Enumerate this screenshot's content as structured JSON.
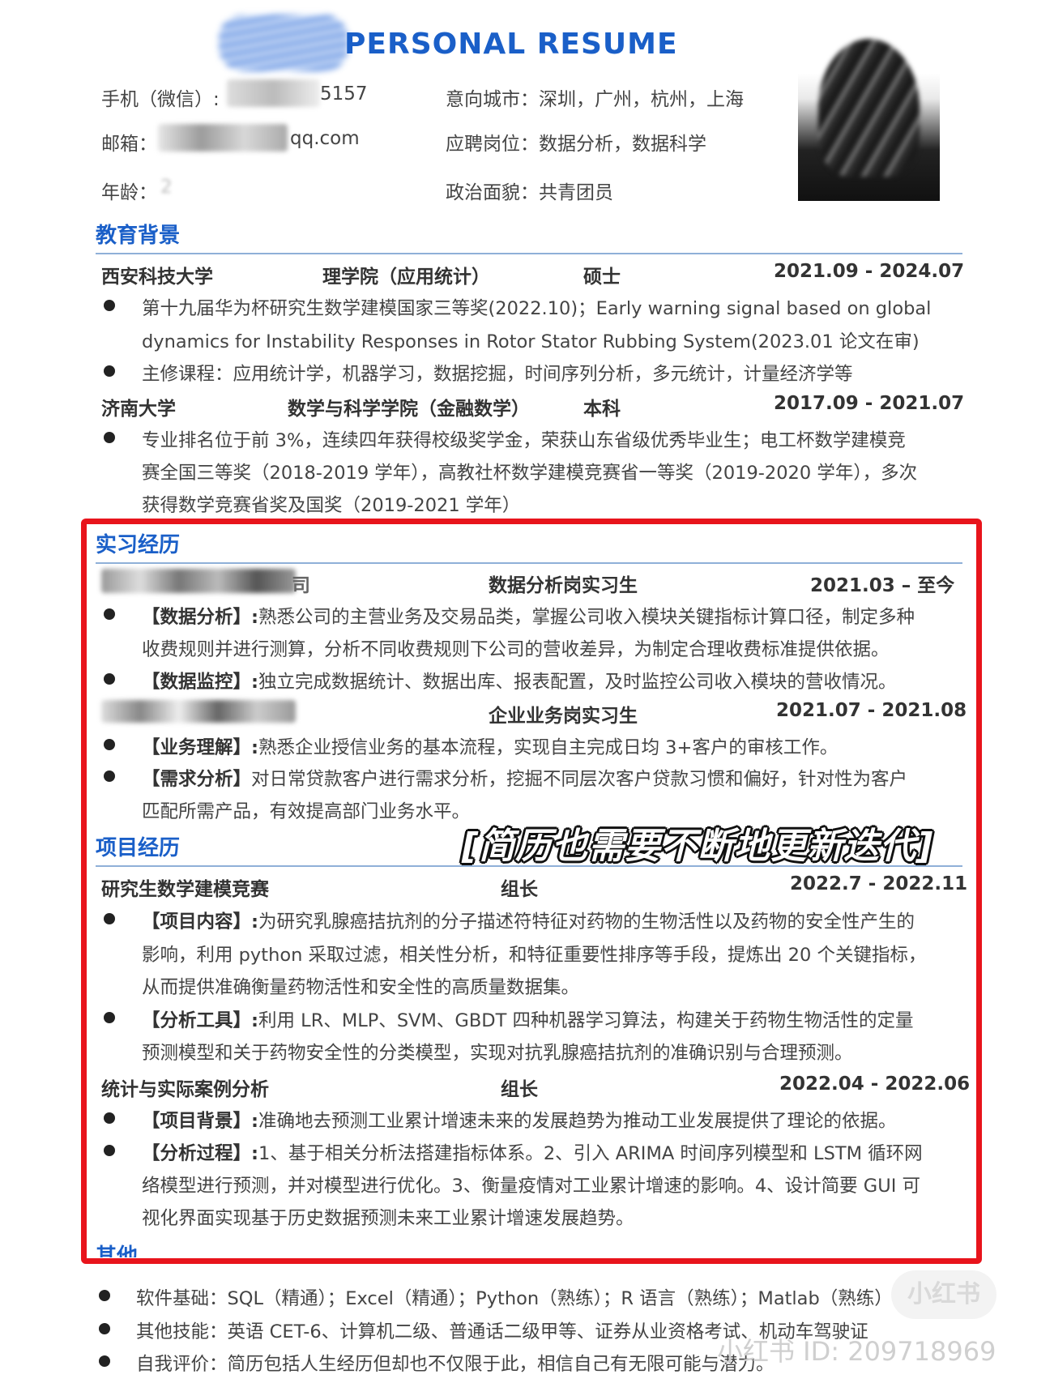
{
  "header": {
    "title": "PERSONAL RESUME",
    "phone_label": "手机（微信）:",
    "phone_tail": "5157",
    "email_label": "邮箱：",
    "email_tail": "qq.com",
    "age_label": "年龄：",
    "age_value": "2",
    "city": "意向城市：深圳，广州，杭州，上海",
    "position": "应聘岗位：数据分析，数据科学",
    "political": "政治面貌：共青团员"
  },
  "education": {
    "heading": "教育背景",
    "schools": [
      {
        "name": "西安科技大学",
        "college": "理学院（应用统计）",
        "degree": "硕士",
        "period": "2021.09 - 2024.07",
        "lines": [
          "第十九届华为杯研究生数学建模国家三等奖(2022.10)；Early warning signal based on global",
          "dynamics for Instability Responses in Rotor Stator Rubbing System(2023.01 论文在审)",
          "主修课程：应用统计学，机器学习，数据挖掘，时间序列分析，多元统计，计量经济学等"
        ]
      },
      {
        "name": "济南大学",
        "college": "数学与科学学院（金融数学）",
        "degree": "本科",
        "period": "2017.09 - 2021.07",
        "lines": [
          "专业排名位于前 3%，连续四年获得校级奖学金，荣获山东省级优秀毕业生；电工杯数学建模竞",
          "赛全国三等奖（2018-2019 学年），高教社杯数学建模竞赛省一等奖（2019-2020 学年），多次",
          "获得数学竞赛省奖及国奖（2019-2021 学年）"
        ]
      }
    ]
  },
  "internship": {
    "heading": "实习经历",
    "jobs": [
      {
        "company_tail": "司",
        "role": "数据分析岗实习生",
        "period": "2021.03 – 至今",
        "items": [
          {
            "tag": "【数据分析】:",
            "text": "熟悉公司的主营业务及交易品类，掌握公司收入模块关键指标计算口径，制定多种"
          },
          {
            "tag": "",
            "text": "收费规则并进行测算，分析不同收费规则下公司的营收差异，为制定合理收费标准提供依据。"
          },
          {
            "tag": "【数据监控】:",
            "text": "独立完成数据统计、数据出库、报表配置，及时监控公司收入模块的营收情况。"
          }
        ]
      },
      {
        "company_tail": "",
        "role": "企业业务岗实习生",
        "period": "2021.07 - 2021.08",
        "items": [
          {
            "tag": "【业务理解】:",
            "text": "熟悉企业授信业务的基本流程，实现自主完成日均 3+客户的审核工作。"
          },
          {
            "tag": "【需求分析】",
            "text": "对日常贷款客户进行需求分析，挖掘不同层次客户贷款习惯和偏好，针对性为客户"
          },
          {
            "tag": "",
            "text": "匹配所需产品，有效提高部门业务水平。"
          }
        ]
      }
    ]
  },
  "projects": {
    "heading": "项目经历",
    "items": [
      {
        "name": "研究生数学建模竞赛",
        "role": "组长",
        "period": "2022.7 - 2022.11",
        "lines": [
          {
            "tag": "【项目内容】:",
            "text": "为研究乳腺癌拮抗剂的分子描述符特征对药物的生物活性以及药物的安全性产生的"
          },
          {
            "tag": "",
            "text": "影响，利用 python 采取过滤，相关性分析，和特征重要性排序等手段，提炼出 20 个关键指标，"
          },
          {
            "tag": "",
            "text": "从而提供准确衡量药物活性和安全性的高质量数据集。"
          },
          {
            "tag": "【分析工具】:",
            "text": "利用 LR、MLP、SVM、GBDT 四种机器学习算法，构建关于药物生物活性的定量"
          },
          {
            "tag": "",
            "text": "预测模型和关于药物安全性的分类模型，实现对抗乳腺癌拮抗剂的准确识别与合理预测。"
          }
        ]
      },
      {
        "name": "统计与实际案例分析",
        "role": "组长",
        "period": "2022.04 - 2022.06",
        "lines": [
          {
            "tag": "【项目背景】:",
            "text": "准确地去预测工业累计增速未来的发展趋势为推动工业发展提供了理论的依据。"
          },
          {
            "tag": "【分析过程】:",
            "text": "1、基于相关分析法搭建指标体系。2、引入 ARIMA 时间序列模型和 LSTM 循环网"
          },
          {
            "tag": "",
            "text": "络模型进行预测，并对模型进行优化。3、衡量疫情对工业累计增速的影响。4、设计简要 GUI 可"
          },
          {
            "tag": "",
            "text": "视化界面实现基于历史数据预测未来工业累计增速发展趋势。"
          }
        ]
      }
    ]
  },
  "other": {
    "heading": "其他",
    "lines": [
      "软件基础：SQL（精通）；Excel（精通）；Python（熟练）；R 语言（熟练）；Matlab（熟练）",
      "其他技能：英语 CET-6、计算机二级、普通话二级甲等、证券从业资格考试、机动车驾驶证",
      "自我评价：简历包括人生经历但却也不仅限于此，相信自己有无限可能与潜力。"
    ]
  },
  "overlay": {
    "caption": "[简历也需要不断地更新迭代]",
    "watermark": "小红书 ID: 209718969",
    "logo": "小红书"
  },
  "colors": {
    "heading": "#1a5fc8",
    "highlight_box": "#e8141c",
    "rule": "#8fb0d8"
  }
}
